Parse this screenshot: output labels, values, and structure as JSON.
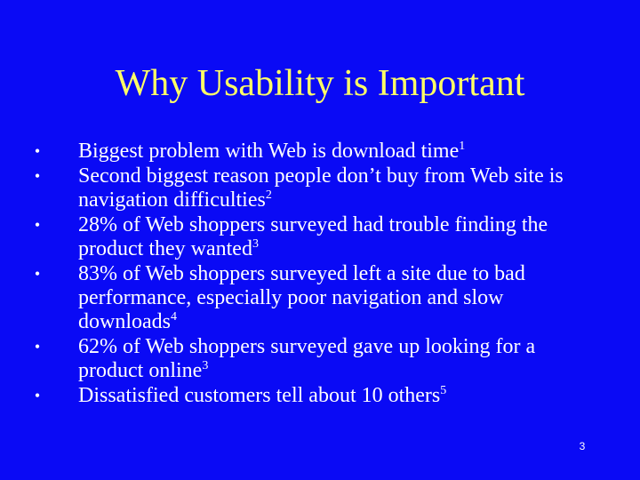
{
  "slide": {
    "title": "Why Usability is Important",
    "bullet_glyph": "•",
    "bullets": [
      {
        "text": "Biggest problem with Web is download time",
        "ref": "1"
      },
      {
        "text": "Second biggest reason people don’t buy from Web site is navigation difficulties",
        "ref": "2"
      },
      {
        "text": "28% of Web shoppers surveyed had trouble finding the product they wanted",
        "ref": "3"
      },
      {
        "text": "83% of Web shoppers surveyed left a site due to bad performance, especially poor navigation and slow downloads",
        "ref": "4"
      },
      {
        "text": "62% of Web shoppers surveyed gave up looking for a product online",
        "ref": "3"
      },
      {
        "text": "Dissatisfied customers tell about 10 others",
        "ref": "5"
      }
    ],
    "page_number": "3",
    "colors": {
      "background": "#0A0AF5",
      "title": "#FFFF66",
      "body_text": "#FFFFFF"
    }
  }
}
